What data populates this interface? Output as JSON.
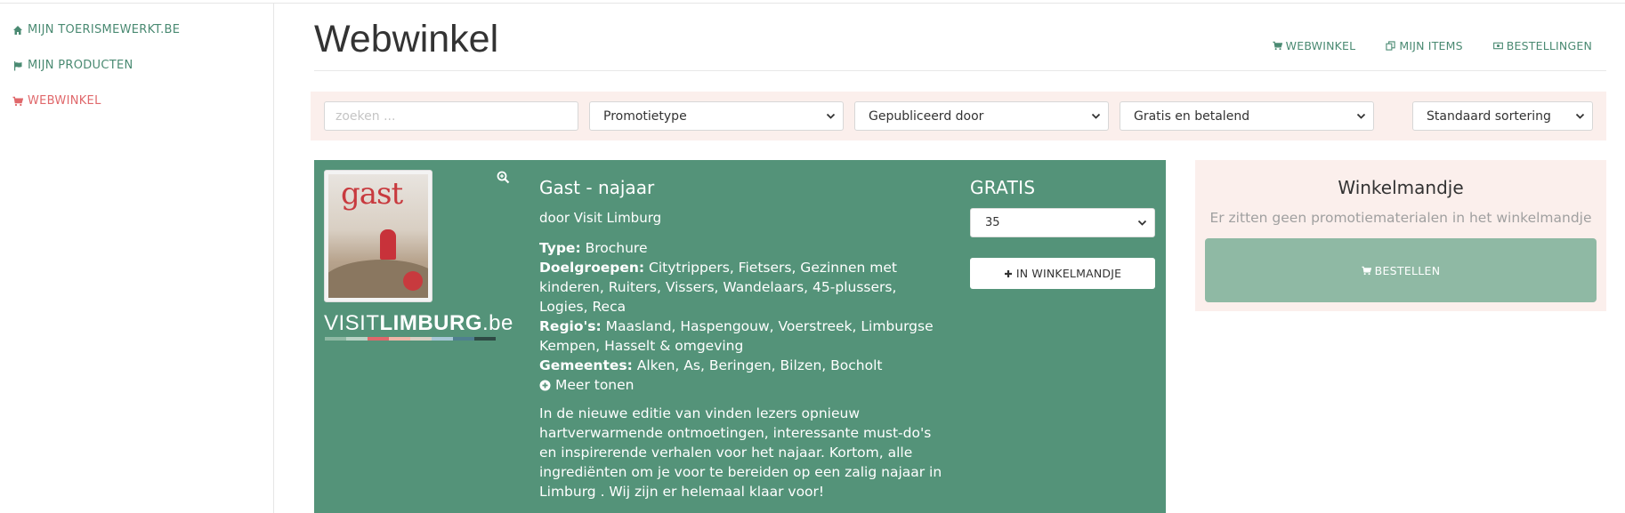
{
  "sidebar": {
    "items": [
      {
        "label": "MIJN TOERISMEWERKT.BE",
        "icon": "home-icon"
      },
      {
        "label": "MIJN PRODUCTEN",
        "icon": "flag-icon"
      },
      {
        "label": "WEBWINKEL",
        "icon": "cart-icon"
      }
    ]
  },
  "header": {
    "title": "Webwinkel",
    "links": [
      {
        "label": "WEBWINKEL",
        "icon": "cart-icon"
      },
      {
        "label": "MIJN ITEMS",
        "icon": "copy-icon"
      },
      {
        "label": "BESTELLINGEN",
        "icon": "money-icon"
      }
    ]
  },
  "filters": {
    "search_placeholder": "zoeken ...",
    "promo_type": "Promotietype",
    "published_by": "Gepubliceerd door",
    "price": "Gratis en betalend",
    "sort": "Standaard sortering"
  },
  "product": {
    "title": "Gast - najaar",
    "by": "door Visit Limburg",
    "type_label": "Type:",
    "type_value": "Brochure",
    "groups_label": "Doelgroepen:",
    "groups_value": "Citytrippers, Fietsers, Gezinnen met kinderen, Ruiters, Vissers, Wandelaars, 45-plussers, Logies, Reca",
    "regions_label": "Regio's:",
    "regions_value": "Maasland, Haspengouw, Voerstreek, Limburgse Kempen, Hasselt & omgeving",
    "municipalities_label": "Gemeentes:",
    "municipalities_value": "Alken, As, Beringen, Bilzen, Bocholt",
    "more_label": "Meer tonen",
    "description": "In de nieuwe editie van vinden lezers opnieuw hartverwarmende ontmoetingen, interessante must-do's en inspirerende verhalen voor het najaar. Kortom, alle ingrediënten om je voor te bereiden op een zalig najaar in Limburg . Wij zijn er helemaal klaar voor!",
    "price": "GRATIS",
    "quantity": "35",
    "add_label": "IN WINKELMANDJE",
    "cover_title": "gast",
    "logo_light": "VISIT",
    "logo_bold": "LIMBURG",
    "logo_tail": ".be"
  },
  "basket": {
    "title": "Winkelmandje",
    "empty_text": "Er zitten geen promotiematerialen in het winkelmandje",
    "order_label": "BESTELLEN"
  },
  "colors": {
    "accent_green": "#549379",
    "link_green": "#4a8a72",
    "active_red": "#e0686b",
    "order_button": "#8fb9a4",
    "panel_pink": "#fbefec"
  }
}
